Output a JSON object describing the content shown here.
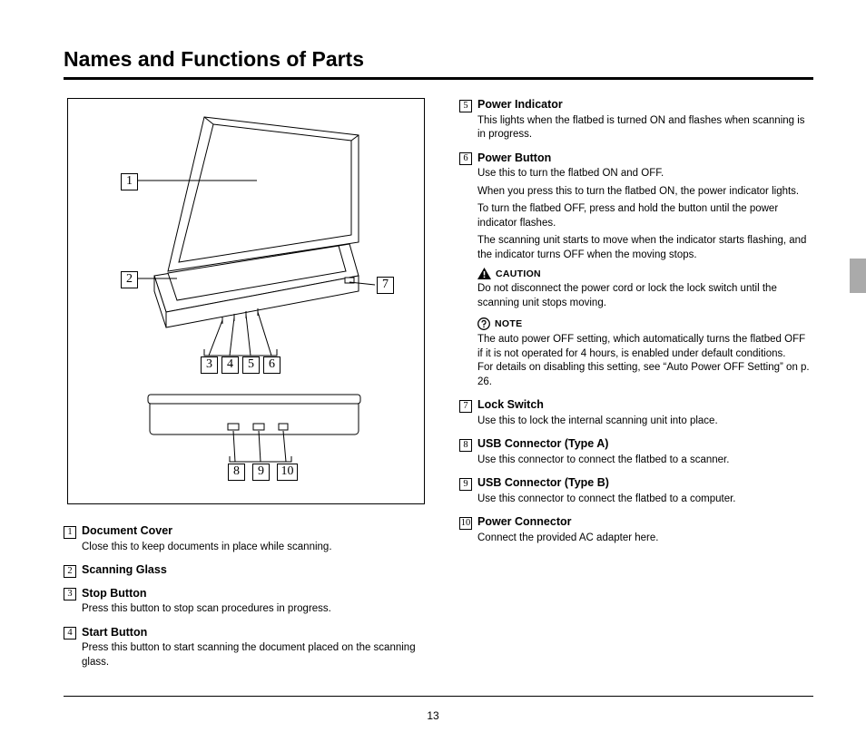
{
  "title": "Names and Functions of Parts",
  "page_number": "13",
  "diagram": {
    "callouts_top": [
      "1",
      "2",
      "7"
    ],
    "callouts_mid": [
      "3",
      "4",
      "5",
      "6"
    ],
    "callouts_bot": [
      "8",
      "9",
      "10"
    ]
  },
  "parts_left": [
    {
      "num": "1",
      "title": "Document Cover",
      "desc": [
        "Close this to keep documents in place while scanning."
      ]
    },
    {
      "num": "2",
      "title": "Scanning Glass",
      "desc": []
    },
    {
      "num": "3",
      "title": "Stop Button",
      "desc": [
        "Press this button to stop scan procedures in progress."
      ]
    },
    {
      "num": "4",
      "title": "Start Button",
      "desc": [
        "Press this button to start scanning the document placed on the scanning glass."
      ]
    }
  ],
  "parts_right": [
    {
      "num": "5",
      "title": "Power Indicator",
      "desc": [
        "This lights when the flatbed is turned ON and flashes when scanning is in progress."
      ]
    },
    {
      "num": "6",
      "title": "Power Button",
      "desc": [
        "Use this to turn the flatbed ON and OFF.",
        "When you press this to turn the flatbed ON, the power indicator lights.",
        "To turn the flatbed OFF, press and hold the button until the power indicator flashes.",
        "The scanning unit starts to move when the indicator starts flashing, and the indicator turns OFF when the moving stops."
      ],
      "caution": {
        "label": "CAUTION",
        "text": "Do not disconnect the power cord or lock the lock switch until the scanning unit stops moving."
      },
      "note": {
        "label": "NOTE",
        "text": "The auto power OFF setting, which automatically turns the flatbed OFF if it is not operated for 4 hours, is enabled under default conditions.\nFor details on disabling this setting, see “Auto Power OFF Setting” on p. 26."
      }
    },
    {
      "num": "7",
      "title": "Lock Switch",
      "desc": [
        "Use this to lock the internal scanning unit into place."
      ]
    },
    {
      "num": "8",
      "title": "USB Connector (Type A)",
      "desc": [
        "Use this connector to connect the flatbed to a scanner."
      ]
    },
    {
      "num": "9",
      "title": "USB Connector (Type B)",
      "desc": [
        "Use this connector to connect the flatbed to a computer."
      ]
    },
    {
      "num": "10",
      "title": "Power Connector",
      "desc": [
        "Connect the provided AC adapter here."
      ]
    }
  ]
}
